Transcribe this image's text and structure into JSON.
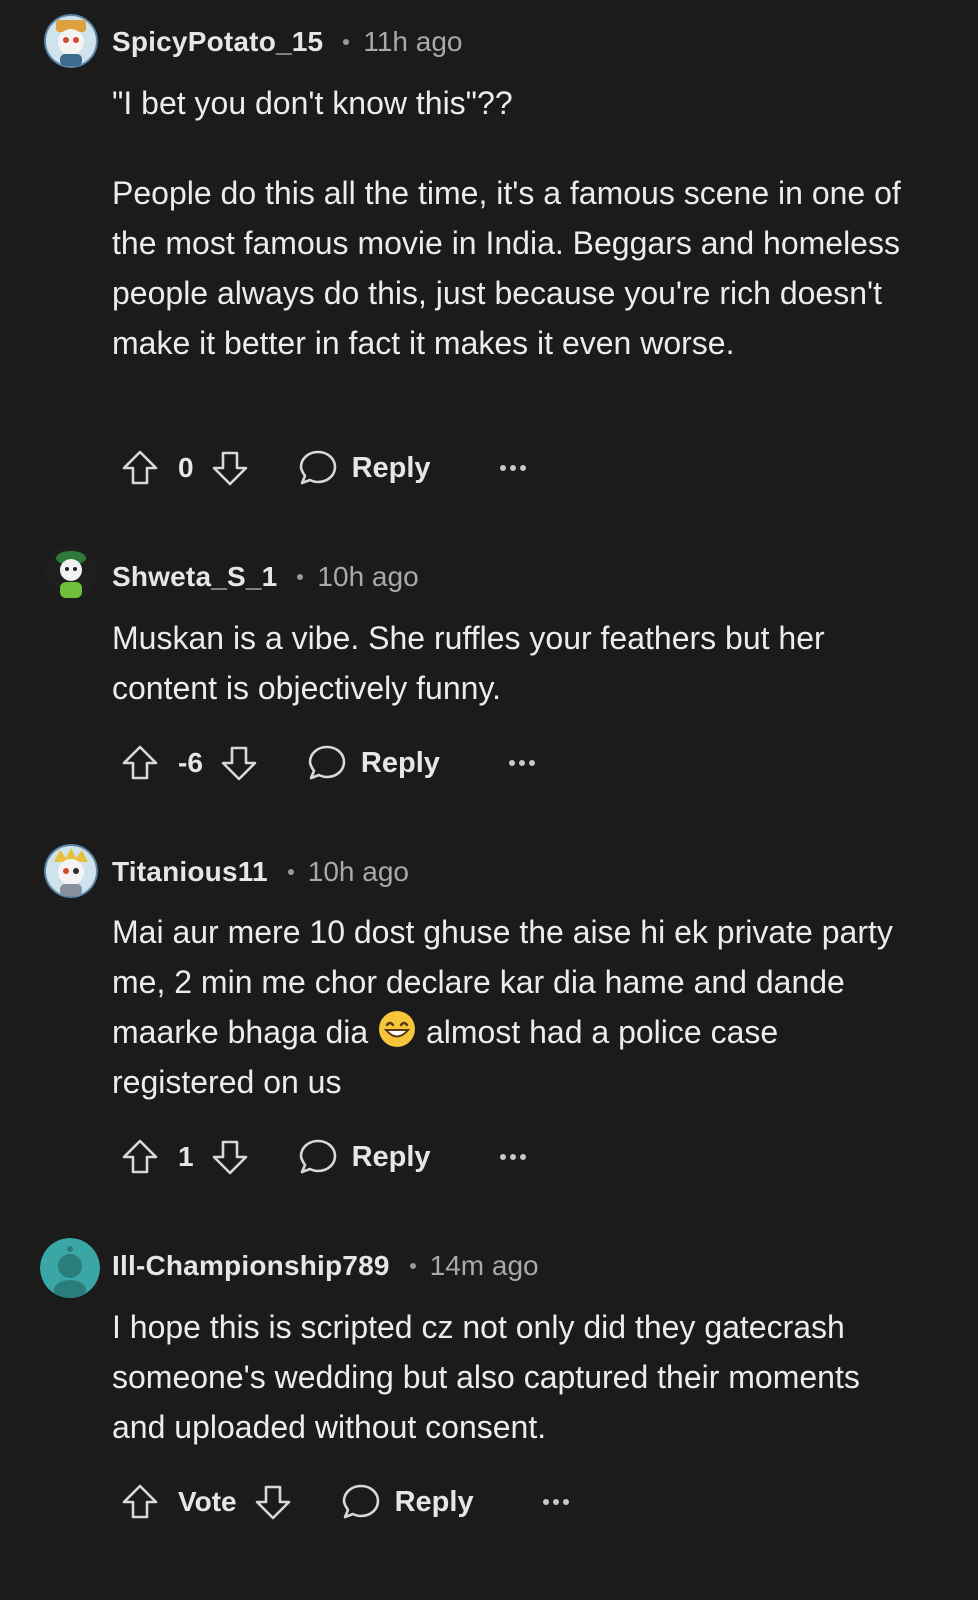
{
  "comments": [
    {
      "username": "SpicyPotato_15",
      "time": "11h ago",
      "paragraphs": [
        "\"I bet you don't know this\"??",
        "People do this all the time, it's a famous scene in one of the most famous movie in India. Beggars and homeless people always do this, just because you're rich doesn't make it better in fact it makes it even worse."
      ],
      "score": "0",
      "reply_label": "Reply"
    },
    {
      "username": "Shweta_S_1",
      "time": "10h ago",
      "paragraphs": [
        "Muskan is a vibe. She ruffles your feathers but her content is objectively funny."
      ],
      "score": "-6",
      "reply_label": "Reply"
    },
    {
      "username": "Titanious11",
      "time": "10h ago",
      "text_before_emoji": "Mai aur mere 10 dost ghuse the aise hi ek private party me, 2 min me chor declare kar dia hame and dande maarke bhaga dia",
      "emoji": "grinning-face-with-smiling-eyes",
      "text_after_emoji": "almost had a police case registered on us",
      "score": "1",
      "reply_label": "Reply"
    },
    {
      "username": "Ill-Championship789",
      "time": "14m ago",
      "paragraphs": [
        "I hope this is scripted cz not only did they gatecrash someone's wedding but also captured their moments and uploaded without consent."
      ],
      "score": "Vote",
      "reply_label": "Reply"
    }
  ],
  "icons": {
    "upvote": "upvote-arrow-icon",
    "downvote": "downvote-arrow-icon",
    "reply": "speech-bubble-icon",
    "more": "ellipsis-icon"
  },
  "colors": {
    "background": "#1b1b1b",
    "text": "#ececec",
    "muted": "#a9a9a9",
    "default_avatar": "#3aa6a6"
  }
}
